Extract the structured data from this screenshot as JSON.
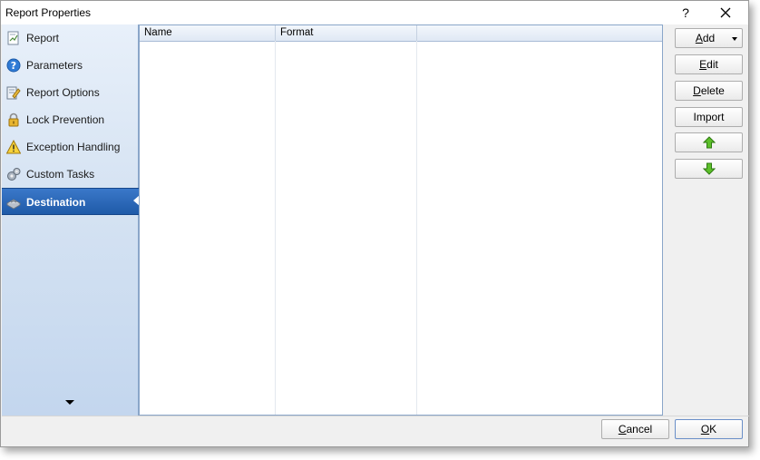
{
  "window": {
    "title": "Report Properties",
    "help_label": "?"
  },
  "sidebar": {
    "items": [
      {
        "label": "Report",
        "icon": "report-icon",
        "active": false
      },
      {
        "label": "Parameters",
        "icon": "question-icon",
        "active": false
      },
      {
        "label": "Report Options",
        "icon": "report-options-icon",
        "active": false
      },
      {
        "label": "Lock Prevention",
        "icon": "lock-icon",
        "active": false
      },
      {
        "label": "Exception Handling",
        "icon": "warning-icon",
        "active": false
      },
      {
        "label": "Custom Tasks",
        "icon": "gears-icon",
        "active": false
      },
      {
        "label": "Destination",
        "icon": "destination-icon",
        "active": true
      }
    ]
  },
  "list": {
    "columns": [
      "Name",
      "Format",
      ""
    ],
    "rows": []
  },
  "buttons": {
    "add": {
      "mnemonic": "A",
      "rest": "dd"
    },
    "edit": {
      "mnemonic": "E",
      "rest": "dit"
    },
    "delete": {
      "mnemonic": "D",
      "rest": "elete"
    },
    "import": {
      "label": "Import"
    },
    "move_up": {
      "icon": "arrow-up-icon"
    },
    "move_down": {
      "icon": "arrow-down-icon"
    }
  },
  "footer": {
    "cancel": {
      "mnemonic": "C",
      "rest": "ancel"
    },
    "ok": {
      "mnemonic": "O",
      "rest": "K"
    }
  },
  "colors": {
    "active_item": "#1f5aa8",
    "sidebar_bottom": "#c3d6ee",
    "arrow_green": "#4caf1e"
  }
}
